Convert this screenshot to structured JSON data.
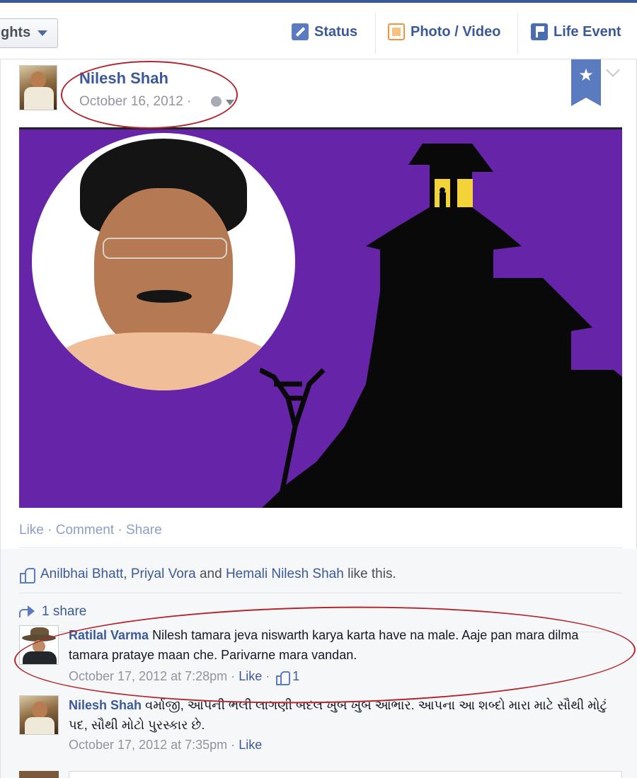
{
  "composer": {
    "highlights_label": "ghts",
    "actions": [
      {
        "label": "Status",
        "icon": "pencil-icon"
      },
      {
        "label": "Photo / Video",
        "icon": "photo-icon"
      },
      {
        "label": "Life Event",
        "icon": "flag-icon"
      }
    ]
  },
  "post": {
    "author": "Nilesh Shah",
    "date": "October 16, 2012",
    "date_separator": "·",
    "audience_icon": "globe-icon",
    "bookmark_icon": "star-icon",
    "actions": {
      "like": "Like",
      "sep1": " · ",
      "comment": "Comment",
      "sep2": " · ",
      "share": "Share"
    }
  },
  "likes": {
    "names": [
      "Anilbhai Bhatt",
      "Priyal Vora",
      "Hemali Nilesh Shah"
    ],
    "comma": ",",
    "and": "and",
    "suffix": "like this."
  },
  "shares": {
    "label": "1 share"
  },
  "comments": [
    {
      "name": "Ratilal Varma",
      "text": "Nilesh tamara jeva niswarth karya karta have na male. Aaje pan mara dilma tamara prataye maan che. Parivarne mara vandan.",
      "time": "October 17, 2012 at 7:28pm",
      "sep": "·",
      "like": "Like",
      "likes_count": "1"
    },
    {
      "name": "Nilesh Shah",
      "text": "વર્માજી, આપની ભલી લાગણી બદલ ખુબ ખુબ આભાર. આપના આ શબ્દો મારા માટે સૌથી મોટું પદ, સૌથી મોટો પુરસ્કાર છે.",
      "time": "October 17, 2012 at 7:35pm",
      "sep": "·",
      "like": "Like"
    }
  ],
  "colors": {
    "brand": "#3b5998",
    "annotation": "#b3262d",
    "photo_bg": "#6624a8",
    "window_light": "#f3d33a"
  }
}
